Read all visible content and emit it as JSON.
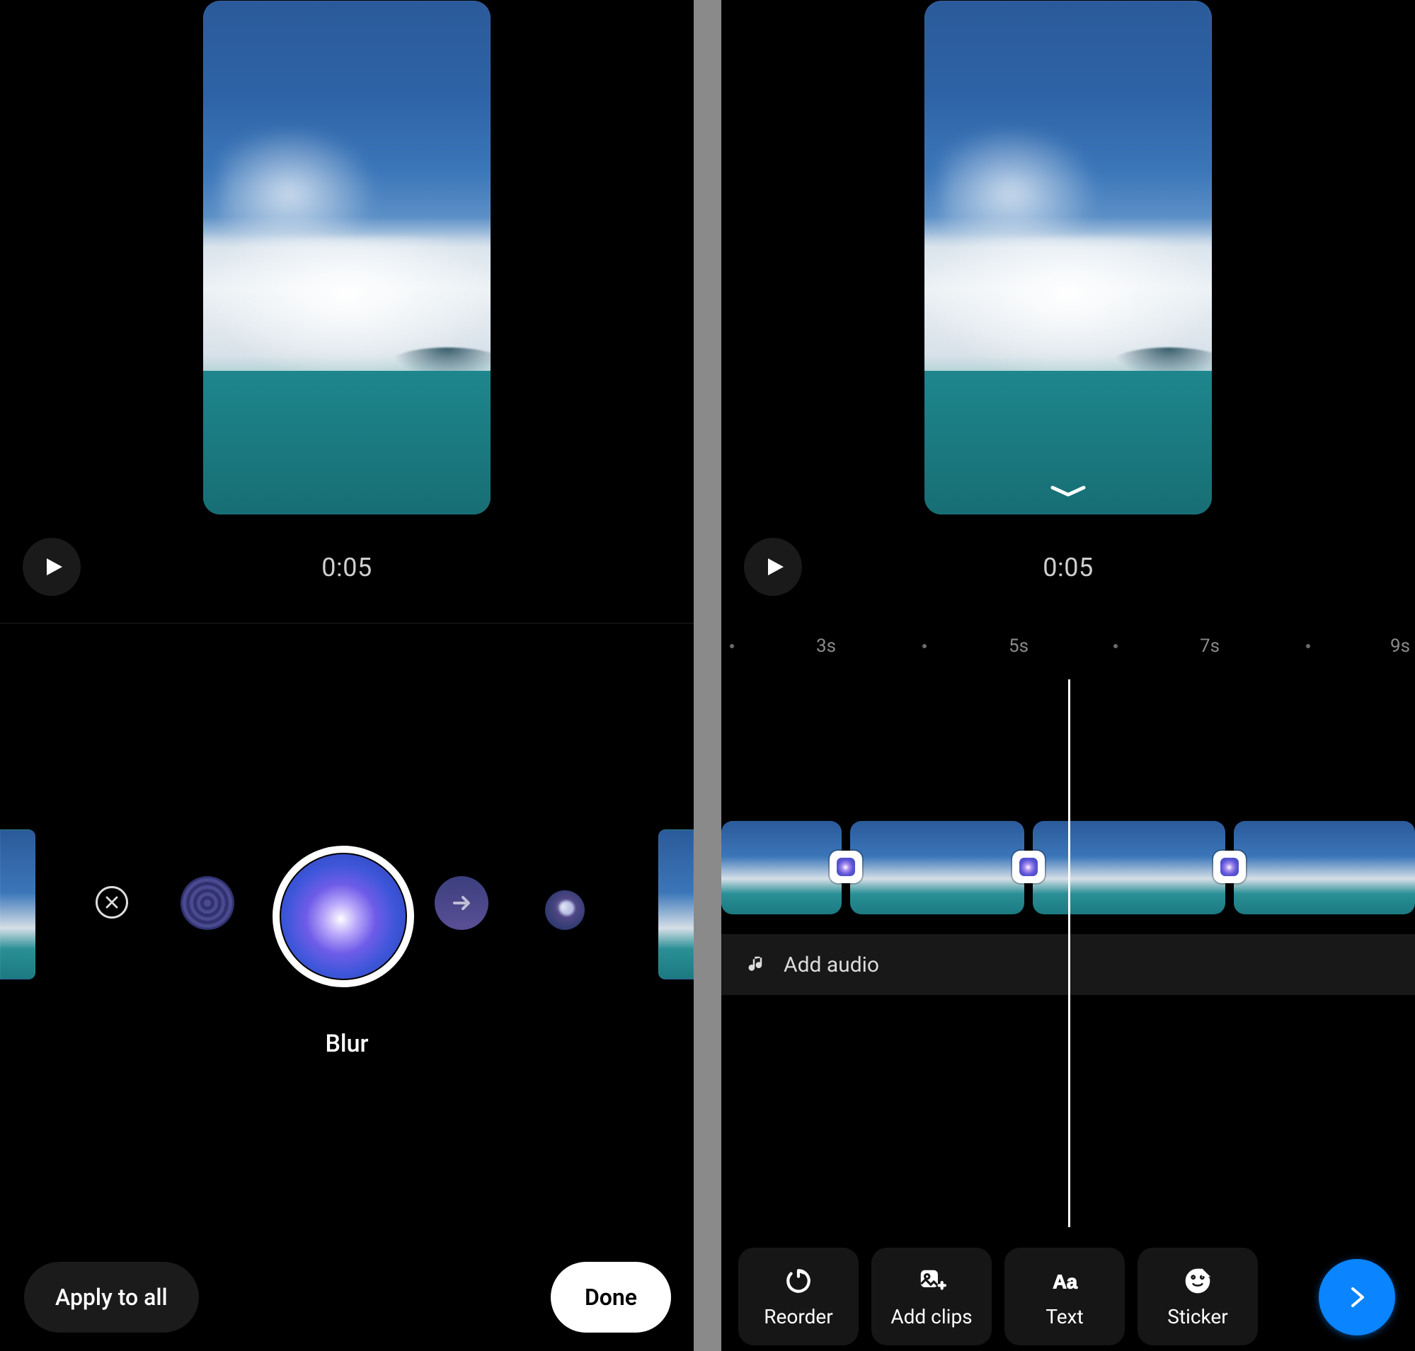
{
  "left": {
    "timecode": "0:05",
    "selected_effect_label": "Blur",
    "apply_all_label": "Apply to all",
    "done_label": "Done",
    "effects": [
      {
        "id": "none"
      },
      {
        "id": "rings"
      },
      {
        "id": "blur",
        "selected": true
      },
      {
        "id": "slide"
      },
      {
        "id": "flare"
      }
    ]
  },
  "right": {
    "timecode": "0:05",
    "ruler_labels": [
      "3s",
      "5s",
      "7s",
      "9s"
    ],
    "add_audio_label": "Add audio",
    "toolbar": [
      {
        "id": "reorder",
        "label": "Reorder"
      },
      {
        "id": "addclips",
        "label": "Add clips"
      },
      {
        "id": "text",
        "label": "Text"
      },
      {
        "id": "sticker",
        "label": "Sticker"
      }
    ]
  }
}
